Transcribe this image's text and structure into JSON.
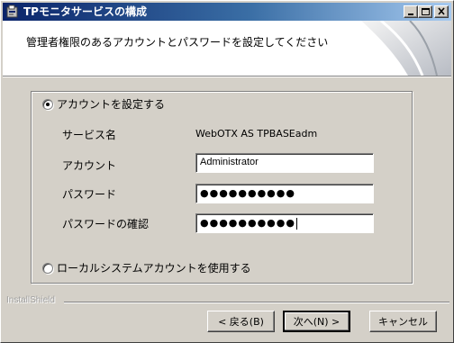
{
  "window": {
    "title": "TPモニタサービスの構成"
  },
  "header": {
    "instruction": "管理者権限のあるアカウントとパスワードを設定してください"
  },
  "options": {
    "set_account": {
      "label": "アカウントを設定する",
      "selected": true
    },
    "local_system": {
      "label": "ローカルシステムアカウントを使用する",
      "selected": false
    }
  },
  "form": {
    "service_name_label": "サービス名",
    "service_name_value": "WebOTX AS TPBASEadm",
    "account_label": "アカウント",
    "account_value": "Administrator",
    "password_label": "パスワード",
    "password_value": "●●●●●●●●●●",
    "password_confirm_label": "パスワードの確認",
    "password_confirm_value": "●●●●●●●●●●"
  },
  "footer": {
    "brand": "InstallShield",
    "back_label": "< 戻る(B)",
    "next_label": "次へ(N) >",
    "cancel_label": "キャンセル"
  }
}
